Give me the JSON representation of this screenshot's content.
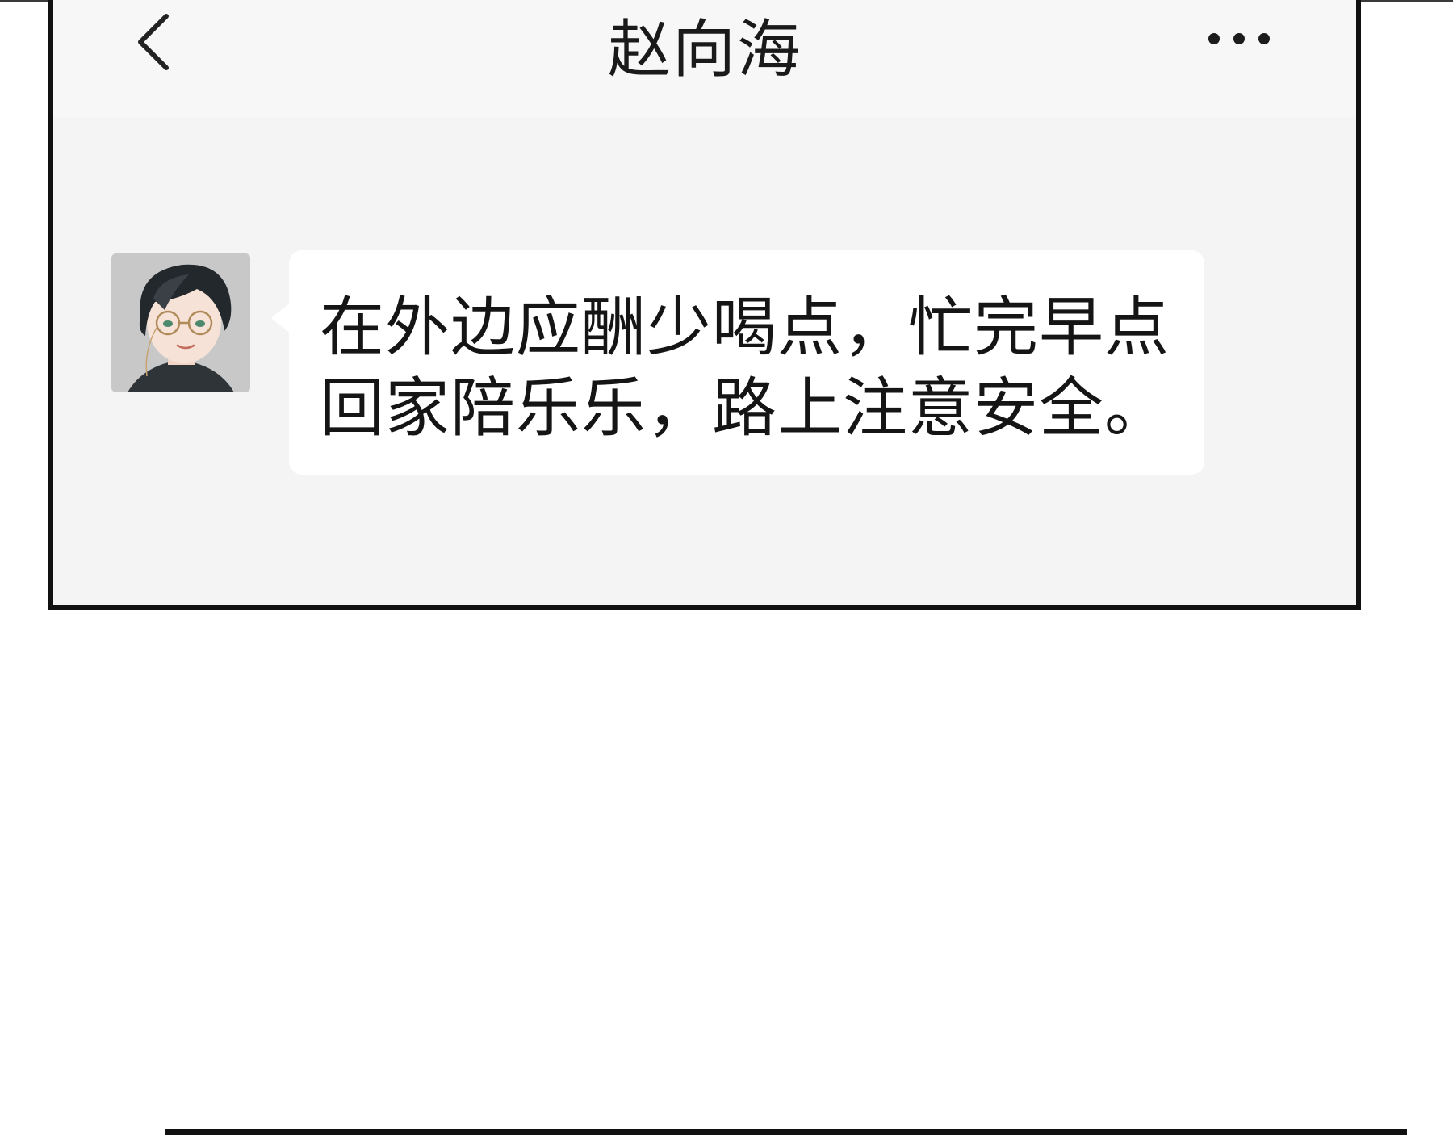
{
  "header": {
    "title": "赵向海",
    "back_icon": "chevron-left-icon",
    "more_icon": "ellipsis-icon"
  },
  "chat": {
    "messages": [
      {
        "sender": "incoming",
        "avatar": "avatar-man-with-glasses",
        "text": "在外边应酬少喝点，忙完早点\n回家陪乐乐，路上注意安全。"
      }
    ]
  },
  "colors": {
    "frame_border": "#111111",
    "chat_background": "#f4f4f5",
    "header_background": "#f7f7f7",
    "bubble_background": "#ffffff",
    "text": "#151515"
  }
}
